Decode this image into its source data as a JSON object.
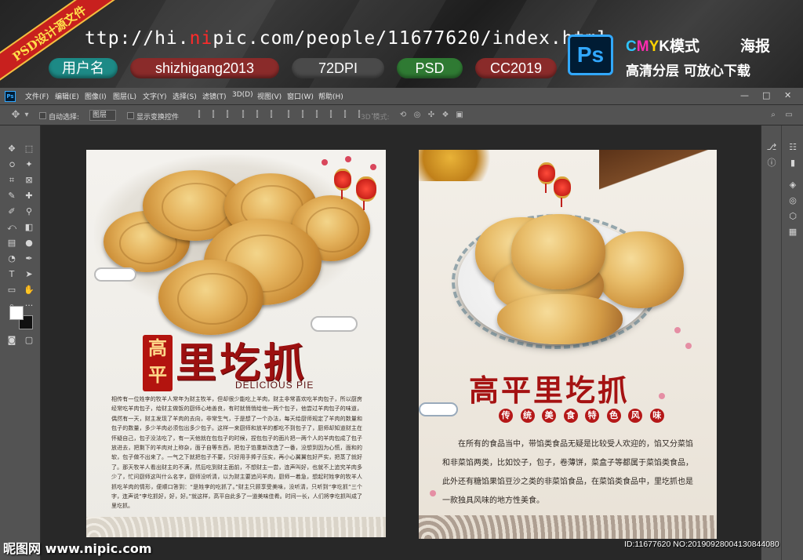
{
  "banner": {
    "ribbon_text": "PSD设计源文件",
    "url_prefix": "ttp://hi.",
    "url_accent": "ni",
    "url_suffix": "pic.com/people/11677620/index.html",
    "pills": [
      {
        "label": "用户名",
        "color": "#1d8a86"
      },
      {
        "label": "shizhigang2013",
        "color": "#8a2b2a"
      },
      {
        "label": "72DPI",
        "color": "#4a4a4a"
      },
      {
        "label": "PSD",
        "color": "#2f7a33"
      },
      {
        "label": "CC2019",
        "color": "#8a2b2a"
      }
    ],
    "ps_logo": "Ps",
    "cmyk_c": "C",
    "cmyk_m": "M",
    "cmyk_y": "Y",
    "cmyk_rest": "K模式",
    "poster_label": "海报",
    "hd_label": "高清分层 可放心下载"
  },
  "menubar": {
    "app_icon": "Ps",
    "items": [
      "文件(F)",
      "编辑(E)",
      "图像(I)",
      "图层(L)",
      "文字(Y)",
      "选择(S)",
      "滤镜(T)",
      "3D(D)",
      "视图(V)",
      "窗口(W)",
      "帮助(H)"
    ],
    "window_controls": [
      "—",
      "□",
      "✕"
    ]
  },
  "optionsbar": {
    "auto_select": "自动选择:",
    "layer_select": "图层",
    "show_transform": "显示变换控件",
    "mode_3d": "3D 模式:"
  },
  "poster1": {
    "badge": "高平",
    "title": "里圪抓",
    "subtitle": "DELICIOUS PIE",
    "body": "相传有一位姓李的牧羊人常年为财主牧羊，但却很少能吃上羊肉，财主非常喜欢吃羊肉包子，所以厨房经常吃羊肉包子，给财主做饭的厨师心地善良，有时就悄悄给他一两个包子，他尝过羊肉包子的味道，偶然有一天，财主发现了羊肉的去向，非常生气，于是想了一个办法，每天给厨师规定了羊肉的数量和包子的数量，多少羊肉必须包出多少包子。这样一来厨师和放羊的都吃不到包子了，厨师却知道财主在怀疑自己，包子没法吃了，有一天他就在包包子的时候，捏包包子的面片把一两个人的羊肉包成了包子放进去，把剩下的羊肉对上称杂，面子自等东西，把包子馅重新改造了一番，没想到因为心慌，面和的软，包子做不出来了。一气之下就把包子不要，只好用手捧子压实，再小心翼翼包好严实，把蒸了就好了。那天牧羊人看出财主的不满，然后吃到财主面前，不想财主一尝，连声叫好，也就不上追究羊肉多少了，忙问厨师这叫什么名字，厨师没听清，以为财主要追问羊肉，厨师一着急，想起时姓李的牧羊人抓吃羊肉的情形，便顺口答到：“是姓李的吃抓了。”财主只顾享受美味，没听清，只听到“李圪抓”三个字，连声说“李圪抓好，好，好。”就这样，高平自此多了一道美味佳肴。时间一长，人们将李圪抓叫成了里圪抓。"
  },
  "poster2": {
    "title": "高平里圪抓",
    "subtitle_chars": [
      "传",
      "统",
      "美",
      "食",
      "特",
      "色",
      "风",
      "味"
    ],
    "body": "在所有的食品当中，带馅类食品无疑是比较受人欢迎的，馅又分菜馅和非菜馅两类，比如饺子，包子，卷薄饼，菜盒子等都属于菜馅类食品，此外还有糖馅果馅豆沙之类的非菜馅食品，在菜馅类食品中，里圪抓也是一款独具风味的地方性美食。"
  },
  "watermark": "昵图网 www.nipic.com",
  "image_id": "ID:11677620 NO:20190928004130844080",
  "colors": {
    "ps_blue": "#31a8ff",
    "title_red": "#9c1010",
    "ui_panel": "#535353",
    "canvas_bg": "#282828"
  }
}
